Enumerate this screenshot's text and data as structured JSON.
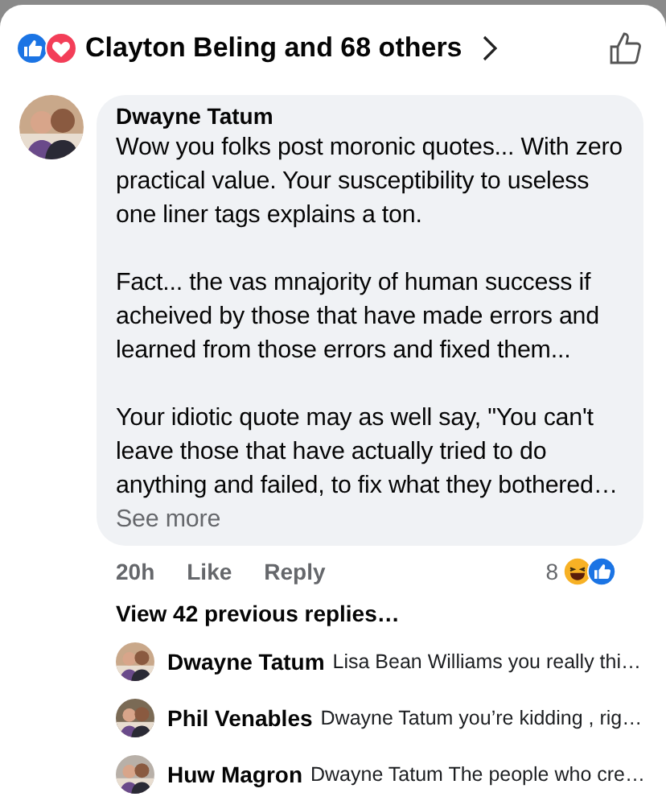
{
  "reactions_bar": {
    "reactions": [
      {
        "kind": "like"
      },
      {
        "kind": "love"
      }
    ],
    "label": "Clayton Beling and 68 others"
  },
  "comment": {
    "author": "Dwayne Tatum",
    "paragraphs": [
      "Wow you folks post moronic quotes... With zero practical value. Your susceptibility to useless one liner tags explains a ton.",
      "Fact... the vas mnajority of human success if acheived by those that have made errors and learned from those errors and fixed them...",
      "Your idiotic quote may as well say, \"You can't leave those that have actually tried to do anything and failed, to fix what they bothered…"
    ],
    "see_more": "See more",
    "time": "20h",
    "actions": [
      "Like",
      "Reply"
    ],
    "reaction_count": "8",
    "reactions": [
      {
        "kind": "haha"
      },
      {
        "kind": "like"
      }
    ]
  },
  "view_previous": "View 42 previous replies…",
  "replies": [
    {
      "author": "Dwayne Tatum",
      "text": "Lisa Bean Williams you really thi…"
    },
    {
      "author": "Phil Venables",
      "text": "Dwayne Tatum you’re kidding , rig…"
    },
    {
      "author": "Huw Magron",
      "text": "Dwayne Tatum The people who cre…"
    }
  ]
}
